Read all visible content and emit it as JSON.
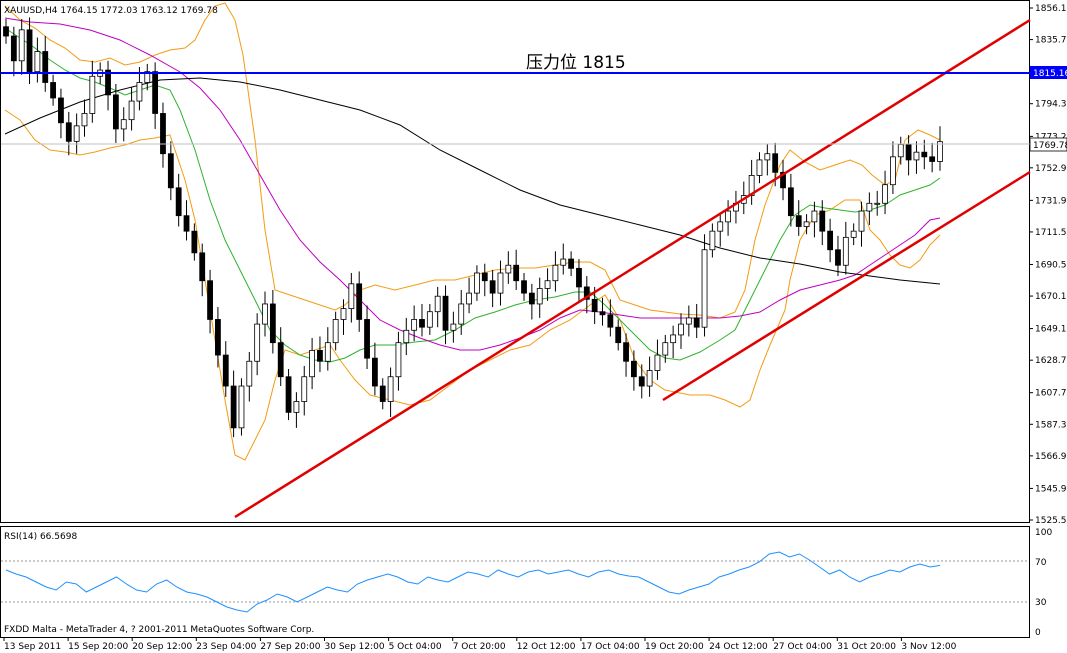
{
  "window": {
    "header": "XAUUSD,H4  1764.15 1772.03 1763.12 1769.78",
    "footer": "FXDD Malta - MetaTrader 4, ? 2001-2011 MetaQuotes Software Corp."
  },
  "annotation": {
    "text": "压力位 1815"
  },
  "price_labels": {
    "resistance": "1815.16",
    "current": "1769.78"
  },
  "rsi": {
    "label": "RSI(14) 66.5698",
    "value": 66.5698,
    "levels": [
      30,
      70
    ],
    "y_ticks": [
      "100",
      "70",
      "30",
      "0"
    ]
  },
  "colors": {
    "up_candle_fill": "#ffffff",
    "down_candle_fill": "#000000",
    "candle_outline": "#000000",
    "bollinger": "#f39c12",
    "ma_fast": "#2db32d",
    "ma_mid": "#c000c0",
    "ma_slow": "#000000",
    "resistance_line": "#0000ff",
    "trend_channel": "#e00000",
    "rsi_line": "#1e90ff",
    "level_line": "#9a9a9a",
    "current_price_line": "#c0c0c0"
  },
  "chart_data": {
    "type": "candlestick",
    "symbol": "XAUUSD",
    "timeframe": "H4",
    "ohlc_last": {
      "open": 1764.15,
      "high": 1772.03,
      "low": 1763.12,
      "close": 1769.78
    },
    "y_range": [
      1525.5,
      1856.1
    ],
    "y_ticks": [
      1856.1,
      1835.7,
      1815.16,
      1794.3,
      1773.2,
      1769.78,
      1752.9,
      1731.9,
      1711.5,
      1690.5,
      1670.1,
      1649.1,
      1628.7,
      1607.7,
      1587.3,
      1566.9,
      1545.9,
      1525.5
    ],
    "y_tick_labels": [
      "1856.10",
      "1835.70",
      "1815.16",
      "1794.30",
      "1773.20",
      "1769.78",
      "1752.90",
      "1731.90",
      "1711.50",
      "1690.50",
      "1670.10",
      "1649.10",
      "1628.70",
      "1607.70",
      "1587.30",
      "1566.90",
      "1545.90",
      "1525.50"
    ],
    "x_ticks": [
      "13 Sep 2011",
      "15 Sep 20:00",
      "20 Sep 12:00",
      "23 Sep 04:00",
      "27 Sep 20:00",
      "30 Sep 12:00",
      "5 Oct 04:00",
      "7 Oct 20:00",
      "12 Oct 12:00",
      "17 Oct 04:00",
      "19 Oct 20:00",
      "24 Oct 12:00",
      "27 Oct 04:00",
      "31 Oct 20:00",
      "3 Nov 12:00"
    ],
    "closes": [
      1838,
      1822,
      1842,
      1815,
      1828,
      1808,
      1798,
      1782,
      1770,
      1780,
      1788,
      1812,
      1816,
      1800,
      1778,
      1784,
      1796,
      1808,
      1815,
      1788,
      1762,
      1740,
      1722,
      1712,
      1698,
      1680,
      1655,
      1632,
      1612,
      1585,
      1612,
      1628,
      1652,
      1665,
      1640,
      1618,
      1595,
      1602,
      1618,
      1635,
      1628,
      1640,
      1655,
      1662,
      1678,
      1655,
      1630,
      1612,
      1602,
      1618,
      1640,
      1648,
      1655,
      1650,
      1660,
      1670,
      1648,
      1652,
      1665,
      1672,
      1685,
      1680,
      1672,
      1685,
      1690,
      1680,
      1672,
      1665,
      1675,
      1680,
      1690,
      1694,
      1688,
      1676,
      1668,
      1660,
      1658,
      1650,
      1640,
      1628,
      1618,
      1612,
      1622,
      1632,
      1640,
      1645,
      1652,
      1656,
      1650,
      1700,
      1712,
      1718,
      1725,
      1730,
      1735,
      1748,
      1758,
      1762,
      1750,
      1740,
      1722,
      1715,
      1718,
      1725,
      1712,
      1700,
      1690,
      1708,
      1712,
      1725,
      1730,
      1730,
      1742,
      1760,
      1768,
      1758,
      1763,
      1760,
      1757,
      1769.78
    ],
    "rsi14": [
      62,
      58,
      55,
      50,
      45,
      42,
      50,
      48,
      40,
      45,
      50,
      55,
      48,
      42,
      40,
      48,
      52,
      45,
      40,
      38,
      35,
      30,
      25,
      22,
      20,
      28,
      32,
      38,
      35,
      30,
      35,
      40,
      45,
      42,
      40,
      48,
      52,
      55,
      58,
      55,
      50,
      48,
      55,
      52,
      50,
      55,
      60,
      58,
      55,
      62,
      58,
      55,
      60,
      62,
      58,
      60,
      62,
      58,
      55,
      60,
      62,
      58,
      56,
      55,
      50,
      45,
      40,
      38,
      42,
      45,
      48,
      55,
      58,
      62,
      65,
      70,
      78,
      80,
      75,
      78,
      72,
      65,
      58,
      62,
      55,
      50,
      55,
      58,
      62,
      60,
      65,
      68,
      65,
      66.57
    ],
    "resistance": 1815.16,
    "channel": {
      "upper": [
        [
          1665,
          1700.0
        ],
        [
          1945,
          1782.0
        ]
      ],
      "lower": [
        [
          1245,
          1604.0
        ],
        [
          1770,
          1760.0
        ]
      ]
    }
  }
}
